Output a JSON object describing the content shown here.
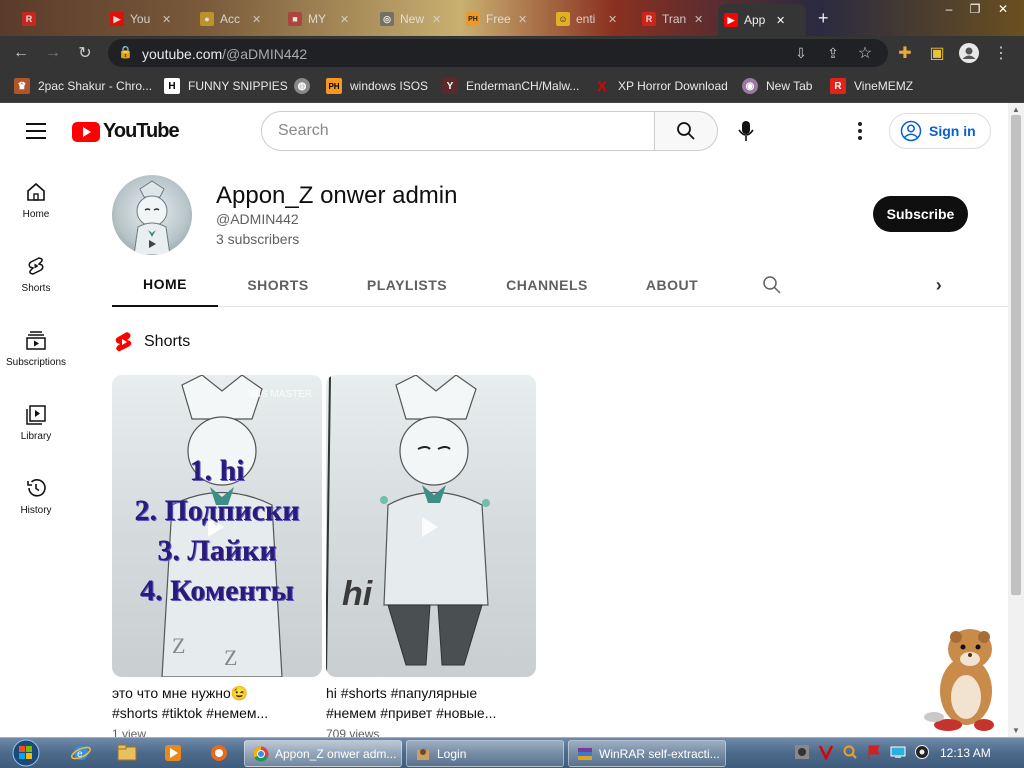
{
  "browser": {
    "tabs": [
      {
        "title": "",
        "icon": "roblox-icon",
        "color": "#e2231a",
        "letter": "R"
      },
      {
        "title": "You",
        "icon": "youtube-icon",
        "color": "#ff0000",
        "letter": "▶"
      },
      {
        "title": "Acc",
        "icon": "account-icon",
        "color": "#c9a227",
        "letter": "●"
      },
      {
        "title": "MY",
        "icon": "site-icon",
        "color": "#b03a3a",
        "letter": "■"
      },
      {
        "title": "New",
        "icon": "chrome-icon",
        "color": "#666666",
        "letter": "◎"
      },
      {
        "title": "Free",
        "icon": "ph-icon",
        "color": "#f7971d",
        "letter": "PH"
      },
      {
        "title": "enti",
        "icon": "emoji-icon",
        "color": "#f3c623",
        "letter": "☺"
      },
      {
        "title": "Tran",
        "icon": "roblox-icon",
        "color": "#e2231a",
        "letter": "R"
      },
      {
        "title": "App",
        "icon": "youtube-icon",
        "color": "#ff0000",
        "letter": "▶"
      }
    ],
    "url_host": "youtube.com",
    "url_path": "/@aDMIN442",
    "bookmarks": [
      {
        "label": "2pac Shakur - Chro...",
        "icon": "bookmark-icon",
        "color": "#b0552a",
        "letter": "♛"
      },
      {
        "label": "FUNNY SNIPPIES",
        "icon": "h-icon",
        "color": "#222222",
        "letter": "H"
      },
      {
        "label": "",
        "icon": "globe-icon",
        "color": "#888888",
        "letter": "◍"
      },
      {
        "label": "windows ISOS",
        "icon": "ph-icon",
        "color": "#f7971d",
        "letter": "PH"
      },
      {
        "label": "EndermanCH/Malw...",
        "icon": "yc-icon",
        "color": "#5a2a2a",
        "letter": "Y"
      },
      {
        "label": "XP Horror Download",
        "icon": "x-icon",
        "color": "#d00000",
        "letter": "X"
      },
      {
        "label": "New Tab",
        "icon": "newtab-icon",
        "color": "#9a7aa0",
        "letter": "◉"
      },
      {
        "label": "VineMEMZ",
        "icon": "roblox-icon",
        "color": "#e2231a",
        "letter": "R"
      }
    ]
  },
  "youtube": {
    "logo_text": "YouTube",
    "search_placeholder": "Search",
    "signin_label": "Sign in",
    "sidebar": [
      {
        "label": "Home",
        "icon": "home-icon"
      },
      {
        "label": "Shorts",
        "icon": "shorts-icon"
      },
      {
        "label": "Subscriptions",
        "icon": "subscriptions-icon"
      },
      {
        "label": "Library",
        "icon": "library-icon"
      },
      {
        "label": "History",
        "icon": "history-icon"
      }
    ],
    "channel": {
      "name": "Appon_Z onwer admin",
      "handle": "@ADMIN442",
      "subscribers": "3 subscribers",
      "subscribe_label": "Subscribe"
    },
    "tabs": [
      "HOME",
      "SHORTS",
      "PLAYLISTS",
      "CHANNELS",
      "ABOUT"
    ],
    "active_tab": "HOME",
    "shorts_heading": "Shorts",
    "shorts": [
      {
        "overlay_lines": [
          "1. hi",
          "2. Подписки",
          "3. Лайки",
          "4. Коменты"
        ],
        "watermark": "IBIS MASTER",
        "title_line1": "это что мне нужно😉",
        "title_line2": "#shorts #tiktok #немем...",
        "views": "1 view"
      },
      {
        "overlay_lines": [],
        "badge": "hi",
        "title_line1": "hi #shorts #папулярные",
        "title_line2": "#немем #привет #новые...",
        "views": "709 views"
      }
    ]
  },
  "taskbar": {
    "buttons": [
      {
        "label": "Appon_Z onwer adm...",
        "icon": "chrome-icon"
      },
      {
        "label": "Login",
        "icon": "login-icon"
      },
      {
        "label": "WinRAR self-extracti...",
        "icon": "winrar-icon"
      }
    ],
    "clock": "12:13 AM"
  }
}
